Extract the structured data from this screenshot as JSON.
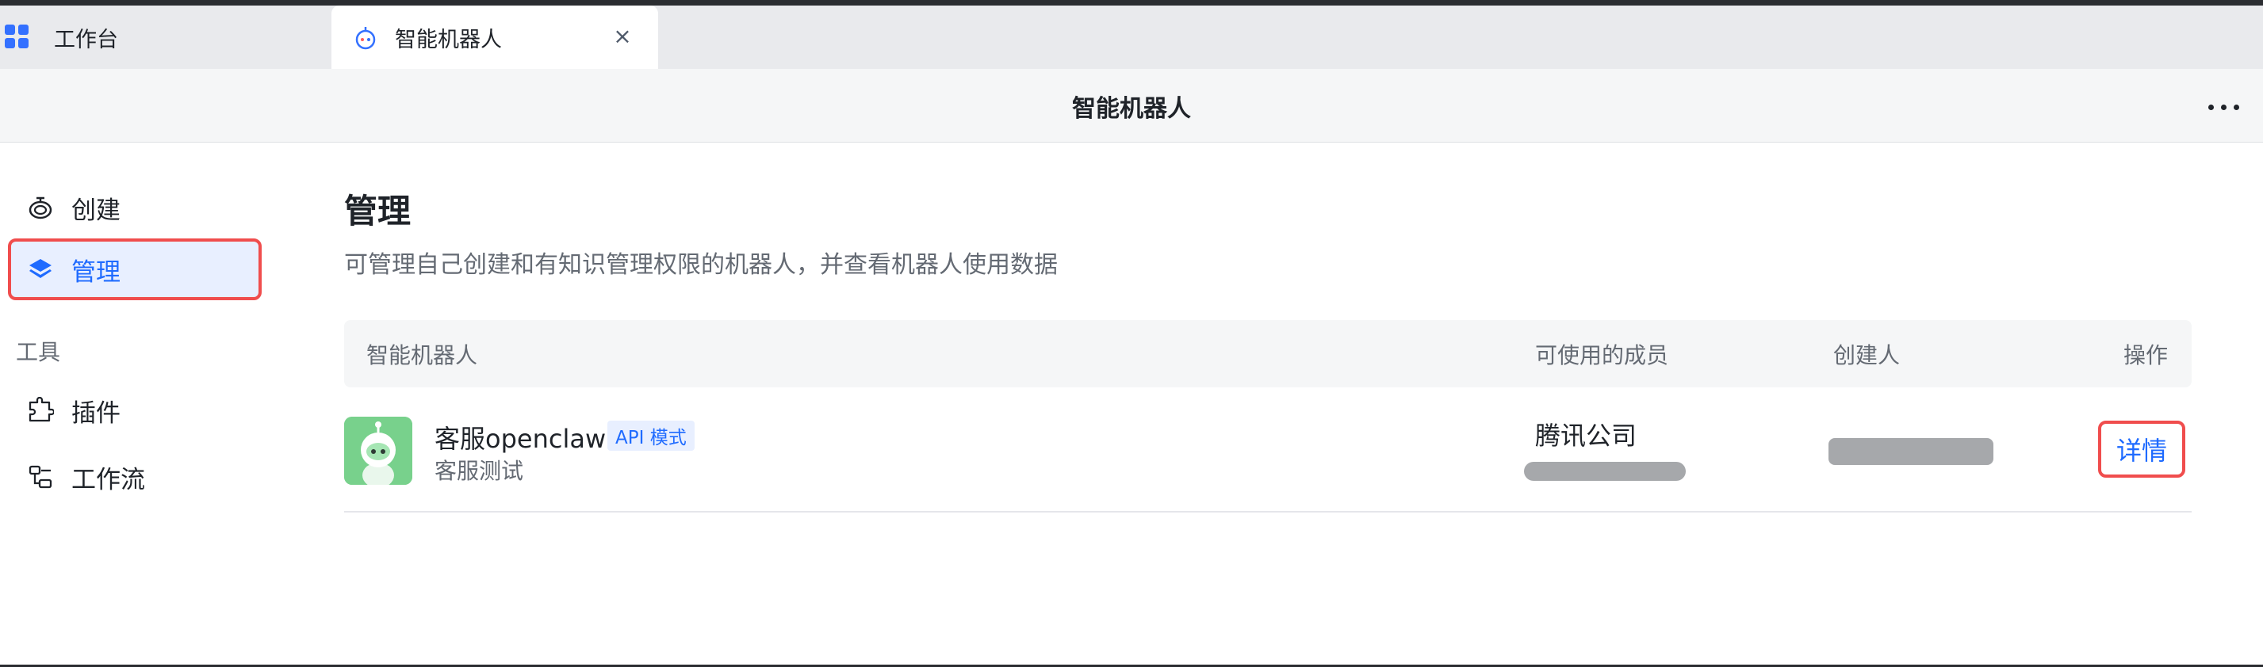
{
  "tabs": [
    {
      "label": "工作台",
      "icon": "grid-icon"
    },
    {
      "label": "智能机器人",
      "icon": "robot-icon",
      "close": "×"
    }
  ],
  "window": {
    "title": "智能机器人",
    "more_icon": "more-dots-icon"
  },
  "sidebar": {
    "items": [
      {
        "label": "创建",
        "icon": "robot-icon"
      },
      {
        "label": "管理",
        "icon": "layers-icon",
        "active": true
      }
    ],
    "section_tools": "工具",
    "tool_items": [
      {
        "label": "插件",
        "icon": "plugin-icon"
      },
      {
        "label": "工作流",
        "icon": "workflow-icon"
      }
    ]
  },
  "main": {
    "title": "管理",
    "description": "可管理自己创建和有知识管理权限的机器人，并查看机器人使用数据",
    "table": {
      "headers": {
        "name": "智能机器人",
        "members": "可使用的成员",
        "creator": "创建人",
        "action": "操作"
      },
      "rows": [
        {
          "name": "客服openclaw",
          "badge": "API 模式",
          "description": "客服测试",
          "members": "腾讯公司",
          "action": "详情"
        }
      ]
    }
  },
  "colors": {
    "accent": "#1f6bff",
    "highlight_border": "#f04d4d",
    "avatar_bg": "#78d18c"
  }
}
